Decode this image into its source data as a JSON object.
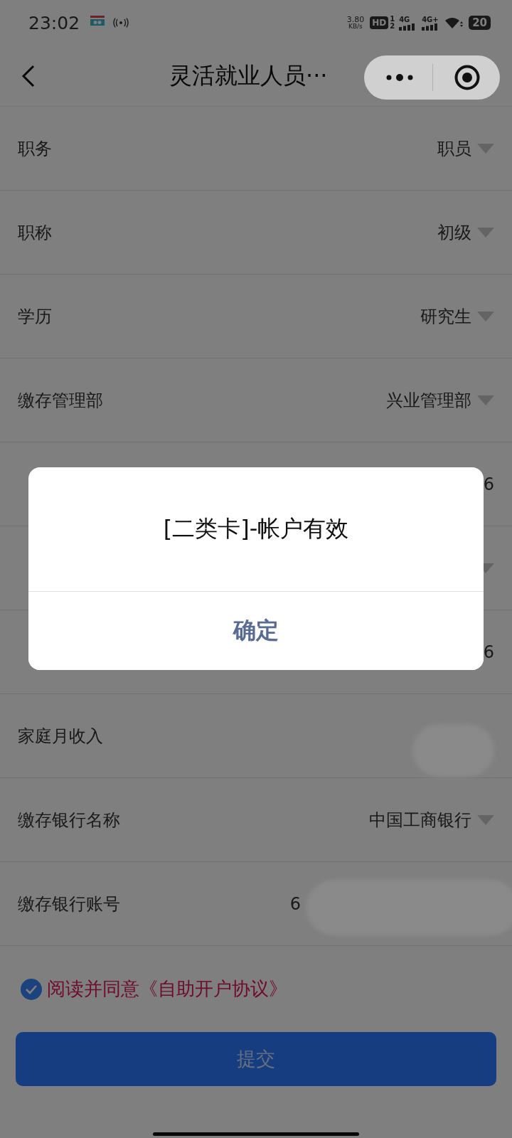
{
  "status_bar": {
    "time": "23:02",
    "net_speed": "3.80",
    "net_unit": "KB/s",
    "hd": "HD",
    "hd_sub": [
      "1",
      "2"
    ],
    "signals": [
      "4G",
      "4G+"
    ],
    "battery": "20"
  },
  "nav": {
    "title": "灵活就业人员···"
  },
  "rows": [
    {
      "label": "职务",
      "value": "职员",
      "kind": "select"
    },
    {
      "label": "职称",
      "value": "初级",
      "kind": "select"
    },
    {
      "label": "学历",
      "value": "研究生",
      "kind": "select"
    },
    {
      "label": "缴存管理部",
      "value": "兴业管理部",
      "kind": "select"
    },
    {
      "value": "6",
      "kind": "text"
    },
    {
      "kind": "select"
    },
    {
      "value": "6",
      "kind": "text"
    },
    {
      "label": "家庭月收入",
      "kind": "text",
      "redacted": true
    },
    {
      "label": "缴存银行名称",
      "value": "中国工商银行",
      "kind": "select"
    },
    {
      "label": "缴存银行账号",
      "value": "6",
      "kind": "text",
      "redacted": true
    }
  ],
  "agreement": {
    "checked": true,
    "text": "阅读并同意《自助开户协议》"
  },
  "submit": {
    "label": "提交"
  },
  "dialog": {
    "message": "[二类卡]-帐户有效",
    "button": "确定"
  }
}
